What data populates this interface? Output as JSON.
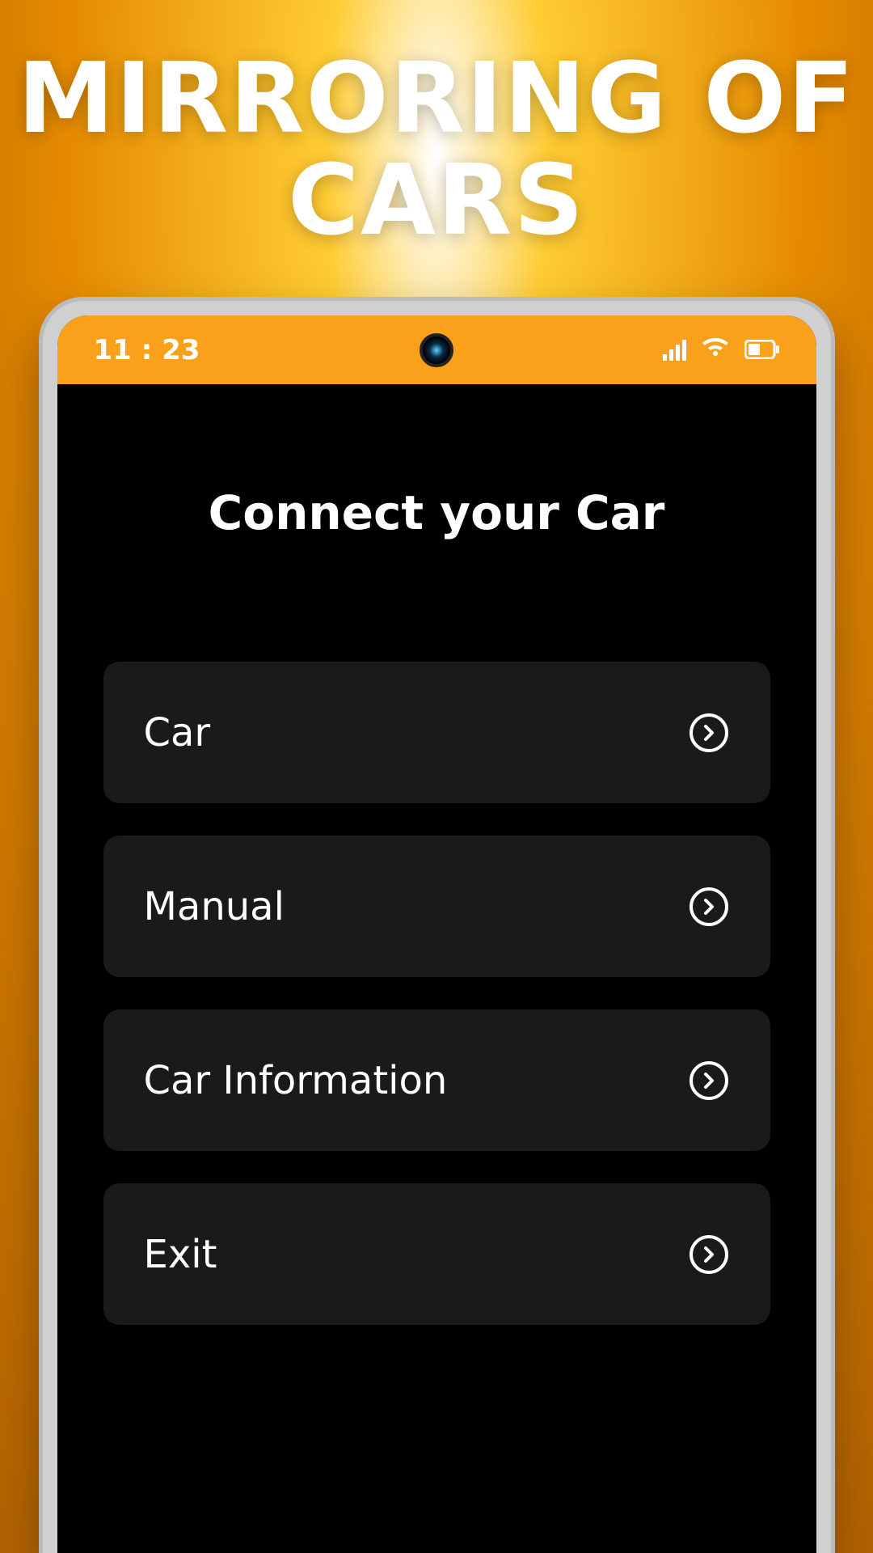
{
  "promo": {
    "title_line1": "MIRRORING OF",
    "title_line2": "CARS"
  },
  "statusbar": {
    "time": "11 : 23",
    "accent": "#f9a11b",
    "icons": {
      "signal": "signal-icon",
      "wifi": "wifi-icon",
      "battery": "battery-icon"
    }
  },
  "screen": {
    "title": "Connect your Car",
    "items": [
      {
        "label": "Car",
        "icon": "arrow-right-circle-icon"
      },
      {
        "label": "Manual",
        "icon": "arrow-right-circle-icon"
      },
      {
        "label": "Car Information",
        "icon": "arrow-right-circle-icon"
      },
      {
        "label": "Exit",
        "icon": "arrow-right-circle-icon"
      }
    ]
  }
}
